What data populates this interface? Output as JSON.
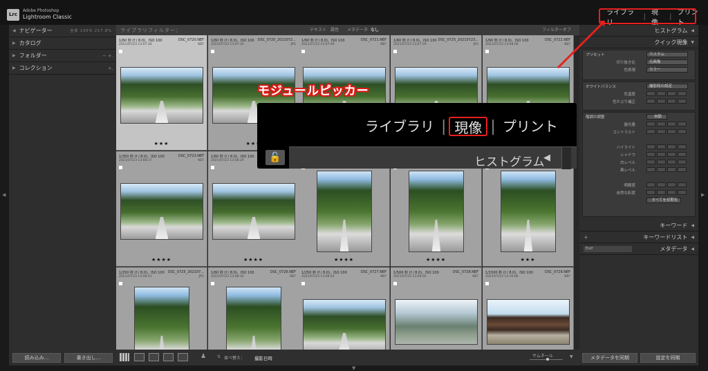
{
  "app": {
    "brand_small": "Adobe Photoshop",
    "brand_name": "Lightroom Classic",
    "logo": "Lrc"
  },
  "modules": [
    "ライブラリ",
    "現像",
    "プリント"
  ],
  "left_panel": {
    "navigator": "ナビゲーター",
    "nav_zoom": "全体   100%   217.8%",
    "catalog": "カタログ",
    "folders": "フォルダー",
    "collections": "コレクション",
    "import_button": "読み込み...",
    "export_button": "書き出し..."
  },
  "filter_bar": {
    "label": "ライブラリフィルター：",
    "options": [
      "テキスト",
      "属性",
      "メタデータ",
      "なし"
    ],
    "filter_off": "フィルターオフ"
  },
  "grid": [
    {
      "info1": "1/60 秒 (f / 8.0)、ISO 100",
      "fname": "DSC_0720.NEF",
      "info2": "2021/07/23 13:07:34",
      "ext": "NEF",
      "stars": "★★★",
      "photo": "land",
      "sel": true
    },
    {
      "info1": "1/60 秒 (f / 8.0)、ISO 100",
      "fname": "DSC_0720_2021072...",
      "info2": "2021/07/23 13:07:34",
      "ext": "JPG",
      "stars": "★★★",
      "photo": "land"
    },
    {
      "info1": "1/60 秒 (f / 8.0)、ISO 100",
      "fname": "DSC_0721.NEF",
      "info2": "2021/07/23 13:07:49",
      "ext": "NEF",
      "stars": "",
      "photo": "land"
    },
    {
      "info1": "1/60 秒 (f / 8.0)、ISO 100",
      "fname": "DSC_0725_20210723...",
      "info2": "2021/07/23 13:07:59",
      "ext": "JPG",
      "stars": "",
      "photo": "land"
    },
    {
      "info1": "1/60 秒 (f / 8.0)、ISO 100",
      "fname": "DSC_0722.NEF",
      "info2": "2021/07/23 13:08:06",
      "ext": "NEF",
      "stars": "",
      "photo": "land"
    },
    {
      "info1": "1/350 秒 (f / 8.0)、ISO 100",
      "fname": "DSC_0723.NEF",
      "info2": "2021/07/23 13:08:17",
      "ext": "NEF",
      "stars": "★★★★",
      "photo": "land"
    },
    {
      "info1": "1/60 秒 (f / 8.0)、ISO 100",
      "fname": "",
      "info2": "2021/07/23 13:08:29",
      "ext": "",
      "stars": "★★★★",
      "photo": "land"
    },
    {
      "info1": "",
      "fname": "",
      "info2": "",
      "ext": "",
      "stars": "★★★★",
      "photo": "port"
    },
    {
      "info1": "",
      "fname": "",
      "info2": "",
      "ext": "",
      "stars": "★★★★",
      "photo": "port"
    },
    {
      "info1": "",
      "fname": "",
      "info2": "",
      "ext": "",
      "stars": "★★★",
      "photo": "port"
    },
    {
      "info1": "1/250 秒 (f / 8.0)、ISO 100",
      "fname": "DSC_0725_202107...",
      "info2": "2021/07/23 13:08:52",
      "ext": "JPG",
      "stars": "",
      "photo": "port"
    },
    {
      "info1": "1/60 秒 (f / 8.0)、ISO 100",
      "fname": "DSC_0726.NEF",
      "info2": "2021/07/23 13:08:34",
      "ext": "NEF",
      "stars": "",
      "photo": "port"
    },
    {
      "info1": "1/250 秒 (f / 8.0)、ISO 100",
      "fname": "DSC_0727.NEF",
      "info2": "2021/07/23 13:08:42",
      "ext": "NEF",
      "stars": "",
      "photo": "land"
    },
    {
      "info1": "1/500 秒 (f / 8.0)、ISO 100",
      "fname": "DSC_0728.NEF",
      "info2": "2021/07/23 13:09:05",
      "ext": "NEF",
      "stars": "",
      "photo": "hazy"
    },
    {
      "info1": "1/1500 秒 (f / 8.0)、ISO 100",
      "fname": "DSC_0729.NEF",
      "info2": "2021/07/23 13:16:06",
      "ext": "NEF",
      "stars": "",
      "photo": "temple"
    }
  ],
  "right_panel": {
    "histogram": "ヒストグラム",
    "quick_develop": "クイック現像",
    "preset_label": "プリセット",
    "preset_value": "カスタム",
    "crop_label": "切り抜き比",
    "crop_value": "元画像",
    "treatment_label": "色表現",
    "treatment_value": "カラー",
    "wb_label": "ホワイトバランス",
    "wb_value": "撮影時の設定",
    "temp": "色温度",
    "tint": "色かぶり補正",
    "tone_label": "階調の調整",
    "auto": "自動",
    "exposure": "露光量",
    "contrast": "コントラスト",
    "highlights": "ハイライト",
    "shadows": "シャドウ",
    "whites": "白レベル",
    "blacks": "黒レベル",
    "clarity": "明瞭度",
    "vibrance": "自然な彩度",
    "reset_all": "すべてを初期化",
    "keywording": "キーワード",
    "keyword_list": "キーワードリスト",
    "metadata": "メタデータ",
    "metadata_preset": "Exif",
    "sync_metadata": "メタデータを同期",
    "sync_settings": "設定を同期"
  },
  "toolbar": {
    "sort_label": "並べ替え：",
    "sort_value": "撮影日時",
    "thumb_label": "サムネール"
  },
  "overlay": {
    "modules": [
      "ライブラリ",
      "現像",
      "プリント"
    ],
    "histogram": "ヒストグラム"
  },
  "callout": "モジュールピッカー",
  "colors": {
    "highlight": "#e8201d",
    "panel": "#2e2e2e",
    "background": "#1a1a1a"
  }
}
